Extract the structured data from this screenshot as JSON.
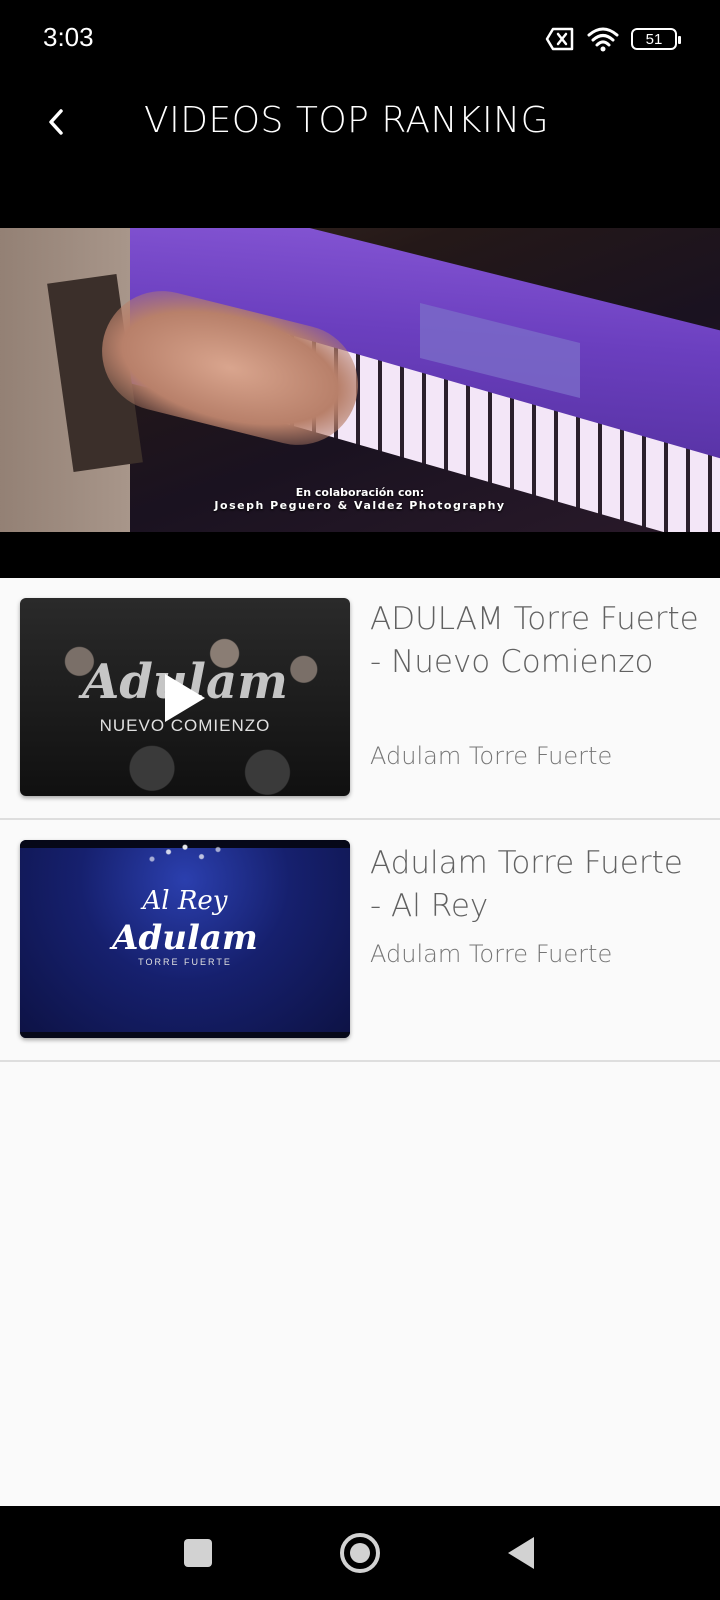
{
  "status_bar": {
    "time": "3:03",
    "battery": "51"
  },
  "app_bar": {
    "title": "VIDEOS TOP RANKING"
  },
  "hero_video": {
    "caption_line1": "En colaboración con:",
    "caption_line2": "Joseph Peguero & Valdez Photography"
  },
  "videos": [
    {
      "title": "ADULAM Torre Fuerte - Nuevo Comienzo",
      "channel": "Adulam Torre Fuerte",
      "thumb_logo": "Adulam",
      "thumb_subtitle": "NUEVO COMIENZO"
    },
    {
      "title": "Adulam Torre Fuerte  -  Al Rey",
      "channel": "Adulam Torre Fuerte",
      "thumb_script": "Al Rey",
      "thumb_logo": "Adulam",
      "thumb_subtitle": "TORRE FUERTE"
    }
  ],
  "colors": {
    "background": "#000000",
    "list_background": "#fafafa",
    "title_text": "#616161",
    "channel_text": "#757575",
    "divider": "#dedede"
  },
  "icons": [
    "sim-off-icon",
    "wifi-icon",
    "battery-icon",
    "back-arrow-icon",
    "play-icon",
    "nav-recent-icon",
    "nav-home-icon",
    "nav-back-icon"
  ]
}
